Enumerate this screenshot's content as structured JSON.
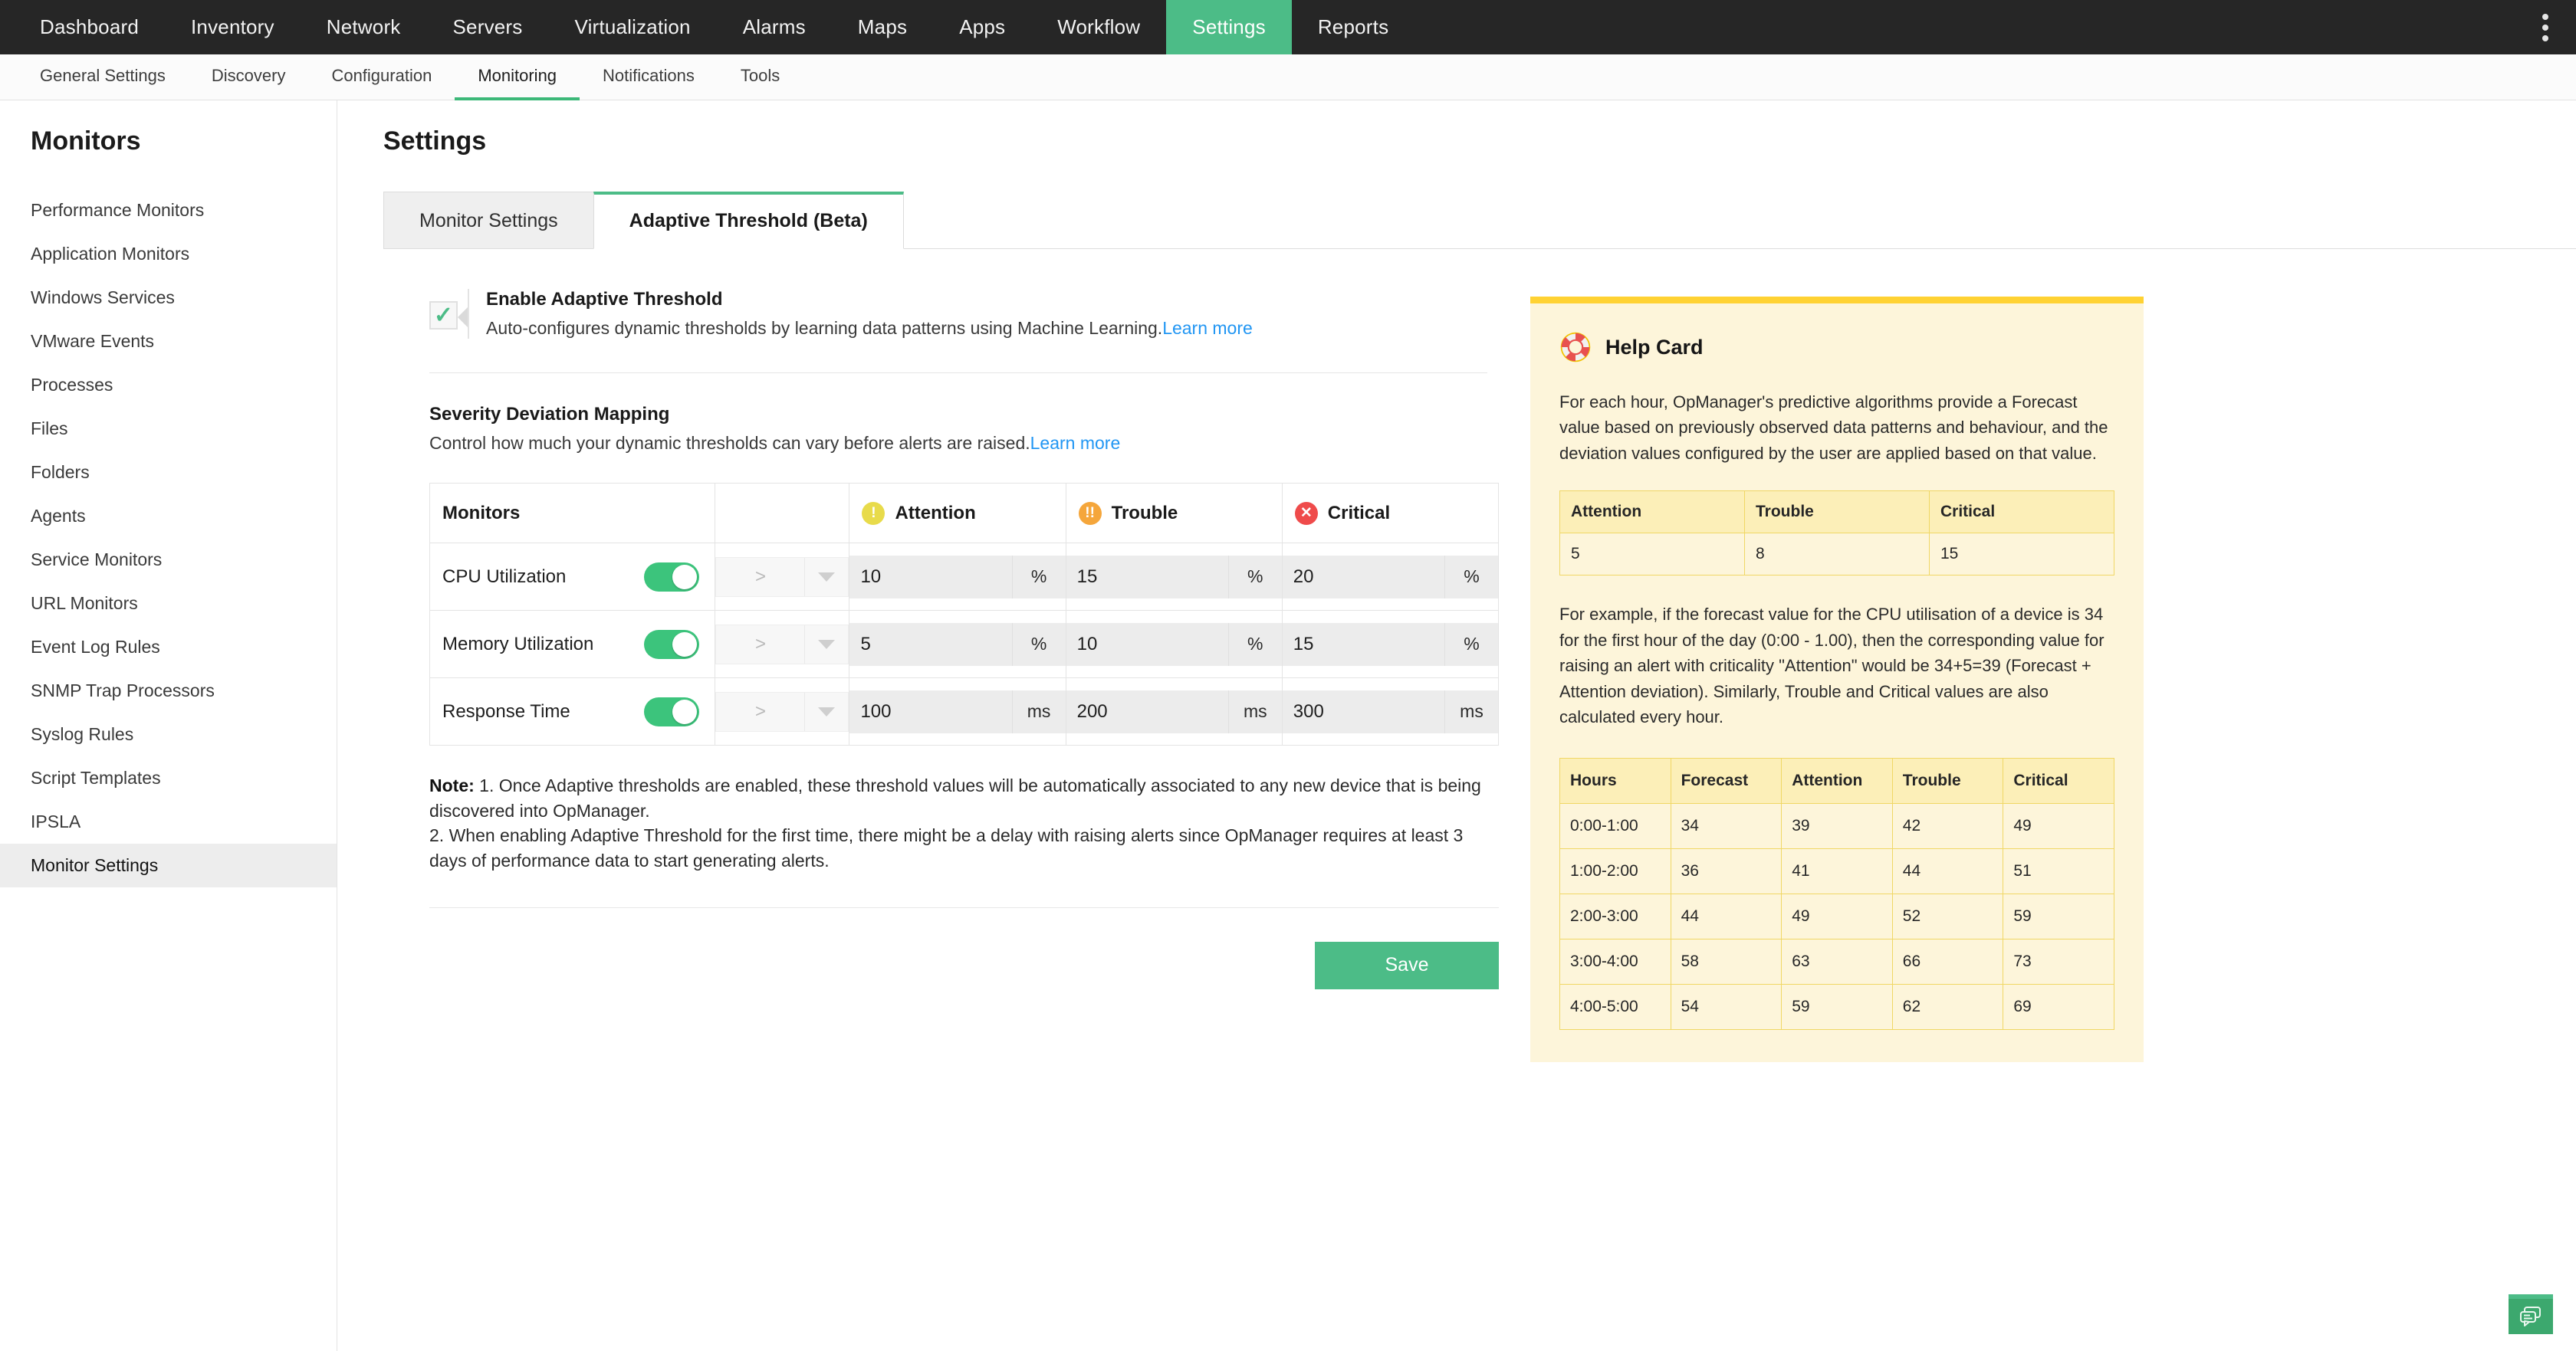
{
  "topnav": {
    "items": [
      {
        "label": "Dashboard",
        "active": false
      },
      {
        "label": "Inventory",
        "active": false
      },
      {
        "label": "Network",
        "active": false
      },
      {
        "label": "Servers",
        "active": false
      },
      {
        "label": "Virtualization",
        "active": false
      },
      {
        "label": "Alarms",
        "active": false
      },
      {
        "label": "Maps",
        "active": false
      },
      {
        "label": "Apps",
        "active": false
      },
      {
        "label": "Workflow",
        "active": false
      },
      {
        "label": "Settings",
        "active": true
      },
      {
        "label": "Reports",
        "active": false
      }
    ],
    "kebab_icon": "more-vertical-icon",
    "active_color": "#4CBC87"
  },
  "subnav": {
    "items": [
      {
        "label": "General Settings",
        "active": false
      },
      {
        "label": "Discovery",
        "active": false
      },
      {
        "label": "Configuration",
        "active": false
      },
      {
        "label": "Monitoring",
        "active": true
      },
      {
        "label": "Notifications",
        "active": false
      },
      {
        "label": "Tools",
        "active": false
      }
    ]
  },
  "sidebar": {
    "title": "Monitors",
    "items": [
      {
        "label": "Performance Monitors",
        "active": false
      },
      {
        "label": "Application Monitors",
        "active": false
      },
      {
        "label": "Windows Services",
        "active": false
      },
      {
        "label": "VMware Events",
        "active": false
      },
      {
        "label": "Processes",
        "active": false
      },
      {
        "label": "Files",
        "active": false
      },
      {
        "label": "Folders",
        "active": false
      },
      {
        "label": "Agents",
        "active": false
      },
      {
        "label": "Service Monitors",
        "active": false
      },
      {
        "label": "URL Monitors",
        "active": false
      },
      {
        "label": "Event Log Rules",
        "active": false
      },
      {
        "label": "SNMP Trap Processors",
        "active": false
      },
      {
        "label": "Syslog Rules",
        "active": false
      },
      {
        "label": "Script Templates",
        "active": false
      },
      {
        "label": "IPSLA",
        "active": false
      },
      {
        "label": "Monitor Settings",
        "active": true
      }
    ]
  },
  "main": {
    "page_title": "Settings",
    "tabs": [
      {
        "label": "Monitor Settings",
        "active": false
      },
      {
        "label": "Adaptive Threshold (Beta)",
        "active": true
      }
    ],
    "enable": {
      "checked": true,
      "check_glyph": "✓",
      "title": "Enable Adaptive Threshold",
      "description": "Auto-configures dynamic thresholds by learning data patterns using Machine Learning.",
      "link_label": "Learn more"
    },
    "severity_section": {
      "title": "Severity Deviation Mapping",
      "description": "Control how much your dynamic thresholds can vary before alerts are raised.",
      "link_label": "Learn more"
    },
    "table": {
      "headers": {
        "monitors": "Monitors",
        "spacer": "",
        "attention": "Attention",
        "trouble": "Trouble",
        "critical": "Critical"
      },
      "severity_icons": {
        "attention": "exclamation-circle-icon",
        "trouble": "double-exclamation-circle-icon",
        "critical": "x-circle-icon"
      },
      "severity_colors": {
        "attention": "#E8DB4B",
        "trouble": "#F5A63B",
        "critical": "#EF4B4B"
      },
      "severity_glyphs": {
        "attention": "!",
        "trouble": "!!",
        "critical": "✕"
      },
      "rows": [
        {
          "monitor": "CPU Utilization",
          "enabled": true,
          "operator": ">",
          "attention": "10",
          "attention_unit": "%",
          "trouble": "15",
          "trouble_unit": "%",
          "critical": "20",
          "critical_unit": "%"
        },
        {
          "monitor": "Memory Utilization",
          "enabled": true,
          "operator": ">",
          "attention": "5",
          "attention_unit": "%",
          "trouble": "10",
          "trouble_unit": "%",
          "critical": "15",
          "critical_unit": "%"
        },
        {
          "monitor": "Response Time",
          "enabled": true,
          "operator": ">",
          "attention": "100",
          "attention_unit": "ms",
          "trouble": "200",
          "trouble_unit": "ms",
          "critical": "300",
          "critical_unit": "ms"
        }
      ]
    },
    "note": {
      "label": "Note:",
      "line1": " 1. Once Adaptive thresholds are enabled, these threshold values will be automatically associated to any new device that is being discovered into OpManager.",
      "line2": "2. When enabling Adaptive Threshold for the first time, there might be a delay with raising alerts since OpManager requires at least 3 days of performance data to start generating alerts."
    },
    "save_label": "Save"
  },
  "help_card": {
    "icon": "lifebuoy-icon",
    "title": "Help Card",
    "intro": "For each hour, OpManager's predictive algorithms provide a Forecast value based on previously observed data patterns and behaviour, and the deviation values configured by the user are applied based on that value.",
    "deviation_table": {
      "headers": [
        "Attention",
        "Trouble",
        "Critical"
      ],
      "row": [
        "5",
        "8",
        "15"
      ]
    },
    "example": "For example, if the forecast value for the CPU utilisation of a device is 34 for the first hour of the day (0:00 - 1.00), then the corresponding value for raising an alert with criticality \"Attention\" would be 34+5=39 (Forecast + Attention deviation). Similarly, Trouble and Critical values are also calculated every hour.",
    "hours_table": {
      "headers": [
        "Hours",
        "Forecast",
        "Attention",
        "Trouble",
        "Critical"
      ],
      "rows": [
        [
          "0:00-1:00",
          "34",
          "39",
          "42",
          "49"
        ],
        [
          "1:00-2:00",
          "36",
          "41",
          "44",
          "51"
        ],
        [
          "2:00-3:00",
          "44",
          "49",
          "52",
          "59"
        ],
        [
          "3:00-4:00",
          "58",
          "63",
          "66",
          "73"
        ],
        [
          "4:00-5:00",
          "54",
          "59",
          "62",
          "69"
        ]
      ]
    },
    "bg_color": "#FDF5DA",
    "accent_color": "#FFD233"
  },
  "chat_fab": {
    "icon": "chat-bubbles-icon",
    "color": "#3CA86E"
  }
}
